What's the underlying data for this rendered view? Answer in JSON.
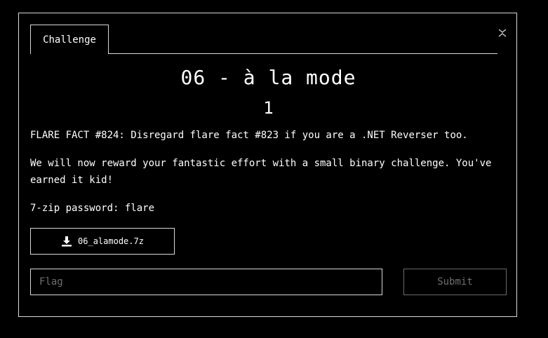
{
  "modal": {
    "tab_label": "Challenge",
    "close_icon": "close-icon",
    "title": "06 - à la mode",
    "points": "1",
    "description": [
      "FLARE FACT #824: Disregard flare fact #823 if you are a .NET Reverser too.",
      "We will now reward your fantastic effort with a small binary challenge. You've earned it kid!",
      "7-zip password: flare"
    ],
    "download": {
      "icon": "download-icon",
      "filename": "06_alamode.7z"
    },
    "flag_input": {
      "placeholder": "Flag",
      "value": ""
    },
    "submit_label": "Submit"
  }
}
